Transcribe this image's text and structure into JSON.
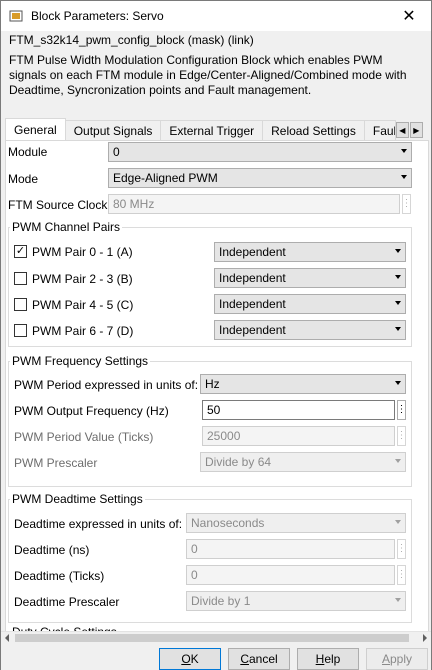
{
  "window": {
    "title": "Block Parameters: Servo",
    "close_glyph": "✕"
  },
  "header": {
    "block_title": "FTM_s32k14_pwm_config_block (mask) (link)",
    "description": "FTM Pulse Width Modulation Configuration Block which enables PWM signals on each FTM module in Edge/Center-Aligned/Combined mode with Deadtime, Syncronization points and Fault management."
  },
  "tabs": [
    {
      "label": "General"
    },
    {
      "label": "Output Signals"
    },
    {
      "label": "External Trigger"
    },
    {
      "label": "Reload Settings"
    },
    {
      "label": "Fault"
    }
  ],
  "tab_scroll": {
    "left": "◀",
    "right": "▶"
  },
  "general": {
    "module_label": "Module",
    "module_value": "0",
    "mode_label": "Mode",
    "mode_value": "Edge-Aligned PWM",
    "source_clock_label": "FTM Source Clock",
    "source_clock_value": "80 MHz"
  },
  "channel_pairs": {
    "title": "PWM Channel Pairs",
    "items": [
      {
        "label": "PWM Pair 0 - 1 (A)",
        "checked": true,
        "mode": "Independent"
      },
      {
        "label": "PWM Pair 2 - 3 (B)",
        "checked": false,
        "mode": "Independent"
      },
      {
        "label": "PWM Pair 4 - 5 (C)",
        "checked": false,
        "mode": "Independent"
      },
      {
        "label": "PWM Pair 6 - 7 (D)",
        "checked": false,
        "mode": "Independent"
      }
    ],
    "check_glyph": "✓"
  },
  "frequency": {
    "title": "PWM Frequency Settings",
    "period_units_label": "PWM Period expressed in units of:",
    "period_units_value": "Hz",
    "output_freq_label": "PWM Output Frequency (Hz)",
    "output_freq_value": "50",
    "period_value_label": "PWM Period Value (Ticks)",
    "period_value_value": "25000",
    "prescaler_label": "PWM Prescaler",
    "prescaler_value": "Divide by 64"
  },
  "deadtime": {
    "title": "PWM Deadtime Settings",
    "units_label": "Deadtime expressed in units of:",
    "units_value": "Nanoseconds",
    "ns_label": "Deadtime (ns)",
    "ns_value": "0",
    "ticks_label": "Deadtime (Ticks)",
    "ticks_value": "0",
    "prescaler_label": "Deadtime Prescaler",
    "prescaler_value": "Divide by 1"
  },
  "duty_cycle": {
    "title": "Duty Cycle Settings"
  },
  "buttons": {
    "ok_u": "O",
    "ok_rest": "K",
    "cancel_u": "C",
    "cancel_rest": "ancel",
    "help_u": "H",
    "help_rest": "elp",
    "apply_u": "A",
    "apply_rest": "pply"
  }
}
